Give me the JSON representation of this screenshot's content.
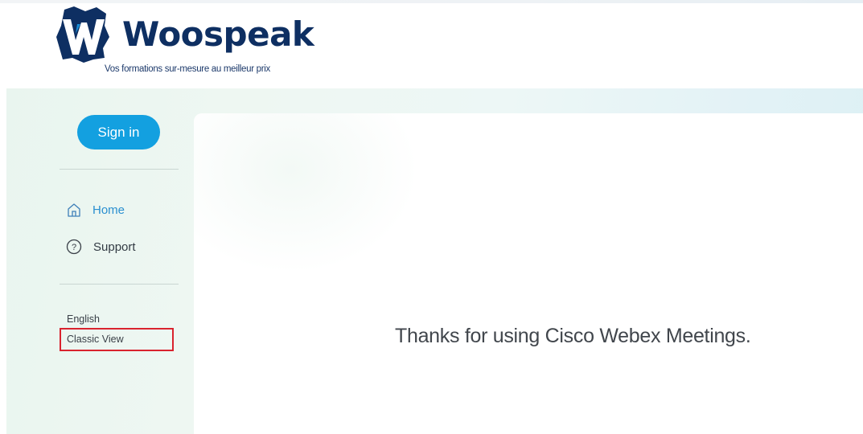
{
  "brand": {
    "name": "Woospeak",
    "tagline": "Vos formations sur-mesure au meilleur prix",
    "logo_icon": "woospeak-w-logo",
    "colors": {
      "navy": "#0e2f62",
      "blue": "#1a8fd8"
    }
  },
  "sidebar": {
    "sign_in_label": "Sign in",
    "nav_items": [
      {
        "label": "Home",
        "icon": "home-icon",
        "active": true
      },
      {
        "label": "Support",
        "icon": "help-circle-icon",
        "active": false
      }
    ],
    "language_label": "English",
    "classic_view_label": "Classic View"
  },
  "main": {
    "message": "Thanks for using Cisco Webex Meetings."
  },
  "colors": {
    "accent": "#13a0e0",
    "highlight_box": "#d9232e",
    "text": "#41464c"
  }
}
